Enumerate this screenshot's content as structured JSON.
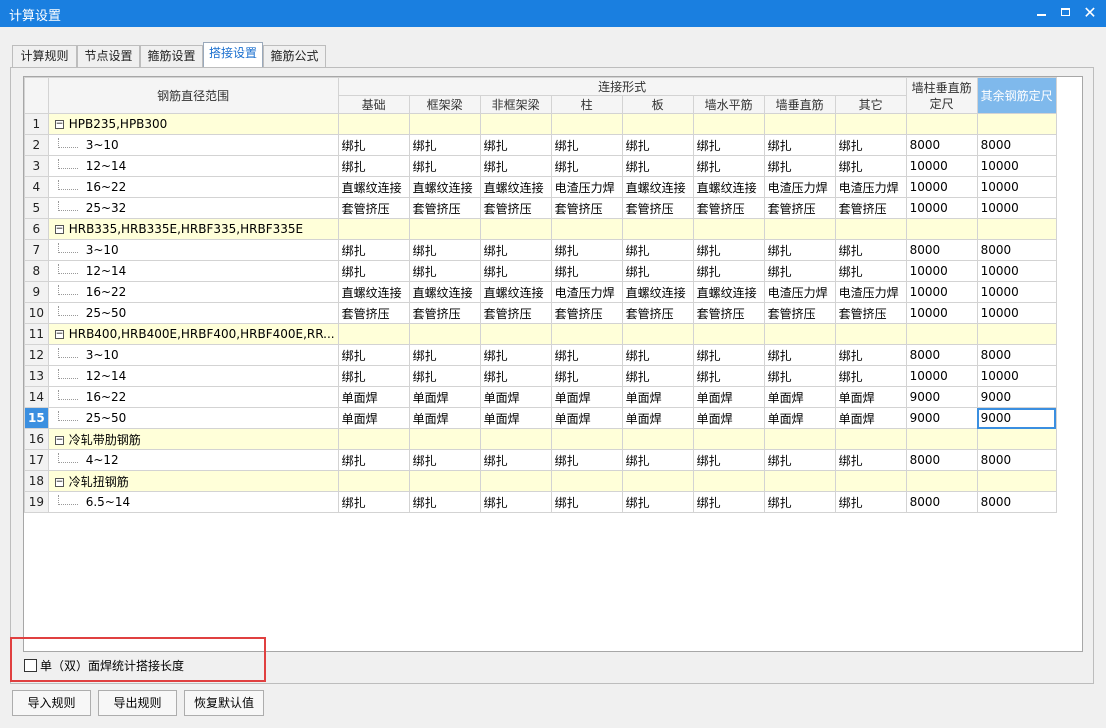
{
  "window": {
    "title": "计算设置",
    "minimize": "–",
    "close": "✕"
  },
  "tabs": [
    "计算规则",
    "节点设置",
    "箍筋设置",
    "搭接设置",
    "箍筋公式"
  ],
  "active_tab": 3,
  "table": {
    "range_header": "钢筋直径范围",
    "group_header": "连接形式",
    "sub_headers": [
      "基础",
      "框架梁",
      "非框架梁",
      "柱",
      "板",
      "墙水平筋",
      "墙垂直筋",
      "其它"
    ],
    "wall_col_header_1": "墙柱垂直筋",
    "wall_col_header_2": "定尺",
    "other_col_header": "其余钢筋定尺",
    "rows": [
      {
        "num": "1",
        "group": true,
        "label": "HPB235,HPB300"
      },
      {
        "num": "2",
        "label": "3~10",
        "cells": [
          "绑扎",
          "绑扎",
          "绑扎",
          "绑扎",
          "绑扎",
          "绑扎",
          "绑扎",
          "绑扎",
          "8000",
          "8000"
        ]
      },
      {
        "num": "3",
        "label": "12~14",
        "cells": [
          "绑扎",
          "绑扎",
          "绑扎",
          "绑扎",
          "绑扎",
          "绑扎",
          "绑扎",
          "绑扎",
          "10000",
          "10000"
        ]
      },
      {
        "num": "4",
        "label": "16~22",
        "cells": [
          "直螺纹连接",
          "直螺纹连接",
          "直螺纹连接",
          "电渣压力焊",
          "直螺纹连接",
          "直螺纹连接",
          "电渣压力焊",
          "电渣压力焊",
          "10000",
          "10000"
        ]
      },
      {
        "num": "5",
        "label": "25~32",
        "cells": [
          "套管挤压",
          "套管挤压",
          "套管挤压",
          "套管挤压",
          "套管挤压",
          "套管挤压",
          "套管挤压",
          "套管挤压",
          "10000",
          "10000"
        ]
      },
      {
        "num": "6",
        "group": true,
        "label": "HRB335,HRB335E,HRBF335,HRBF335E"
      },
      {
        "num": "7",
        "label": "3~10",
        "cells": [
          "绑扎",
          "绑扎",
          "绑扎",
          "绑扎",
          "绑扎",
          "绑扎",
          "绑扎",
          "绑扎",
          "8000",
          "8000"
        ]
      },
      {
        "num": "8",
        "label": "12~14",
        "cells": [
          "绑扎",
          "绑扎",
          "绑扎",
          "绑扎",
          "绑扎",
          "绑扎",
          "绑扎",
          "绑扎",
          "10000",
          "10000"
        ]
      },
      {
        "num": "9",
        "label": "16~22",
        "cells": [
          "直螺纹连接",
          "直螺纹连接",
          "直螺纹连接",
          "电渣压力焊",
          "直螺纹连接",
          "直螺纹连接",
          "电渣压力焊",
          "电渣压力焊",
          "10000",
          "10000"
        ]
      },
      {
        "num": "10",
        "label": "25~50",
        "cells": [
          "套管挤压",
          "套管挤压",
          "套管挤压",
          "套管挤压",
          "套管挤压",
          "套管挤压",
          "套管挤压",
          "套管挤压",
          "10000",
          "10000"
        ]
      },
      {
        "num": "11",
        "group": true,
        "label": "HRB400,HRB400E,HRBF400,HRBF400E,RR..."
      },
      {
        "num": "12",
        "label": "3~10",
        "cells": [
          "绑扎",
          "绑扎",
          "绑扎",
          "绑扎",
          "绑扎",
          "绑扎",
          "绑扎",
          "绑扎",
          "8000",
          "8000"
        ]
      },
      {
        "num": "13",
        "label": "12~14",
        "cells": [
          "绑扎",
          "绑扎",
          "绑扎",
          "绑扎",
          "绑扎",
          "绑扎",
          "绑扎",
          "绑扎",
          "10000",
          "10000"
        ]
      },
      {
        "num": "14",
        "label": "16~22",
        "cells": [
          "单面焊",
          "单面焊",
          "单面焊",
          "单面焊",
          "单面焊",
          "单面焊",
          "单面焊",
          "单面焊",
          "9000",
          "9000"
        ]
      },
      {
        "num": "15",
        "label": "25~50",
        "selected": true,
        "cells": [
          "单面焊",
          "单面焊",
          "单面焊",
          "单面焊",
          "单面焊",
          "单面焊",
          "单面焊",
          "单面焊",
          "9000",
          "9000"
        ]
      },
      {
        "num": "16",
        "group": true,
        "label": "冷轧带肋钢筋"
      },
      {
        "num": "17",
        "label": "4~12",
        "cells": [
          "绑扎",
          "绑扎",
          "绑扎",
          "绑扎",
          "绑扎",
          "绑扎",
          "绑扎",
          "绑扎",
          "8000",
          "8000"
        ]
      },
      {
        "num": "18",
        "group": true,
        "label": "冷轧扭钢筋"
      },
      {
        "num": "19",
        "label": "6.5~14",
        "cells": [
          "绑扎",
          "绑扎",
          "绑扎",
          "绑扎",
          "绑扎",
          "绑扎",
          "绑扎",
          "绑扎",
          "8000",
          "8000"
        ]
      }
    ]
  },
  "checkbox_label": "单（双）面焊统计搭接长度",
  "checkbox_checked": false,
  "buttons": {
    "import": "导入规则",
    "export": "导出规则",
    "restore": "恢复默认值"
  }
}
